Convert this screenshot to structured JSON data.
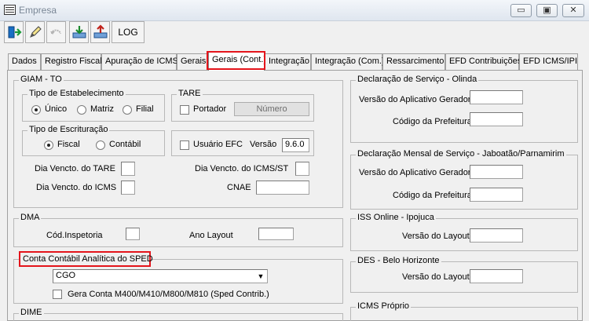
{
  "window": {
    "title": "Empresa",
    "controls": {
      "minimize": "▭",
      "maximize": "▣",
      "close": "✕"
    }
  },
  "toolbar": {
    "buttons": [
      {
        "icon": "exit-door-icon"
      },
      {
        "icon": "pencil-edit-icon"
      },
      {
        "icon": "undo-disabled-icon"
      },
      {
        "icon": "import-tray-icon"
      },
      {
        "icon": "export-tray-icon"
      }
    ],
    "log_label": "LOG"
  },
  "tabs": [
    "Dados",
    "Registro Fiscal",
    "Apuração de ICMS",
    "Gerais",
    "Gerais (Cont.)",
    "Integração",
    "Integração (Com.)",
    "Ressarcimento",
    "EFD Contribuições",
    "EFD ICMS/IPI"
  ],
  "active_tab": "Gerais (Cont.)",
  "giam": {
    "title": "GIAM - TO",
    "tipo_estabelecimento": {
      "title": "Tipo de Estabelecimento",
      "options": [
        "Único",
        "Matriz",
        "Filial"
      ],
      "selected": "Único"
    },
    "tare": {
      "title": "TARE",
      "portador_label": "Portador",
      "numero_button": "Número"
    },
    "tipo_escrituracao": {
      "title": "Tipo de Escrituração",
      "options": [
        "Fiscal",
        "Contábil"
      ],
      "selected": "Fiscal"
    },
    "usuario_efc_label": "Usuário EFC",
    "versao_label": "Versão",
    "versao_value": "9.6.0",
    "dia_vencto_tare_label": "Dia Vencto. do TARE",
    "dia_vencto_tare_value": "",
    "dia_vencto_icms_st_label": "Dia Vencto. do ICMS/ST",
    "dia_vencto_icms_st_value": "",
    "dia_vencto_icms_label": "Dia Vencto. do ICMS",
    "dia_vencto_icms_value": "",
    "cnae_label": "CNAE",
    "cnae_value": ""
  },
  "dma": {
    "title": "DMA",
    "cod_inspetoria_label": "Cód.Inspetoria",
    "cod_inspetoria_value": "",
    "ano_layout_label": "Ano Layout",
    "ano_layout_value": ""
  },
  "sped": {
    "title": "Conta Contábil Analítica do SPED",
    "selected_value": "CGO",
    "gera_conta_label": "Gera Conta M400/M410/M800/M810 (Sped Contrib.)"
  },
  "dime_title": "DIME",
  "olinda": {
    "title": "Declaração de Serviço - Olinda",
    "versao_label": "Versão do Aplicativo Gerador",
    "versao_value": "",
    "codigo_label": "Código da Prefeitura",
    "codigo_value": ""
  },
  "jaboatao": {
    "title": "Declaração Mensal de Serviço - Jaboatão/Parnamirim",
    "versao_label": "Versão do Aplicativo Gerador",
    "versao_value": "",
    "codigo_label": "Código da Prefeitura",
    "codigo_value": ""
  },
  "iss_ipojuca": {
    "title": "ISS Online - Ipojuca",
    "versao_layout_label": "Versão do Layout",
    "versao_layout_value": ""
  },
  "des_bh": {
    "title": "DES - Belo Horizonte",
    "versao_layout_label": "Versão do Layout",
    "versao_layout_value": ""
  },
  "icms_proprio_title": "ICMS Próprio",
  "colors": {
    "highlight": "#e4141b",
    "window_bg": "#f0f0f0",
    "titlebar_text": "#7a8796"
  }
}
